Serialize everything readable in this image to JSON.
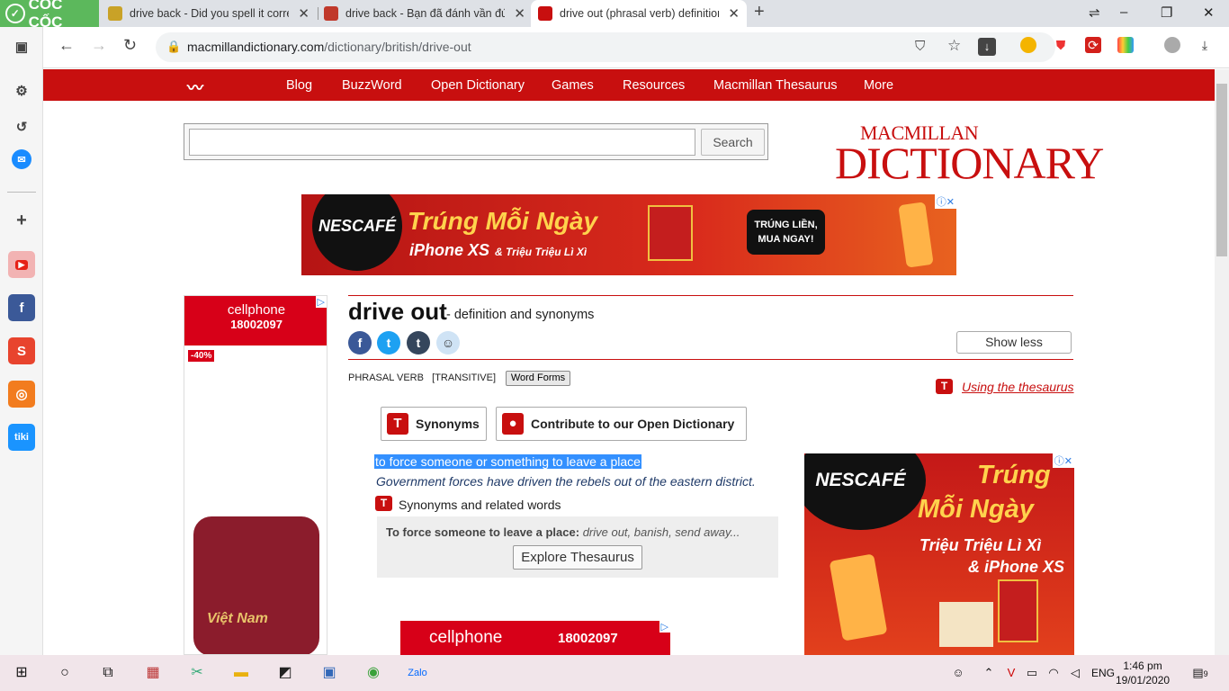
{
  "browser": {
    "brand": "CỐC CỐC",
    "tabs": [
      {
        "title": "drive back - Did you spell it correctly",
        "fav_color": "#c9a227"
      },
      {
        "title": "drive back - Bạn đã đánh vần đúng",
        "fav_color": "#c0392b"
      },
      {
        "title": "drive out (phrasal verb) definition and synonyms",
        "fav_color": "#c80f0f"
      }
    ],
    "url_domain": "macmillandictionary.com",
    "url_path": "/dictionary/british/drive-out"
  },
  "site": {
    "nav": [
      "Blog",
      "BuzzWord",
      "Open Dictionary",
      "Games",
      "Resources",
      "Macmillan Thesaurus",
      "More"
    ],
    "search_button": "Search",
    "logo_top": "MACMILLAN",
    "logo_main": "DICTIONARY"
  },
  "ads": {
    "top_brand": "NESCAFÉ",
    "top_line1": "Trúng Mỗi Ngày",
    "top_line2": "iPhone XS",
    "top_line2b": "& Triệu Triệu Lì Xì",
    "top_cta": "TRÚNG LIỀN, MUA NGAY!",
    "left_brand": "cellphone",
    "left_phone": "18002097",
    "left_discount": "-40%",
    "left_product": "Việt Nam",
    "right_brand": "NESCAFÉ",
    "right_line1": "Trúng",
    "right_line2": "Mỗi Ngày",
    "right_line3": "Triệu Triệu Lì Xì",
    "right_line4": "& iPhone XS",
    "bottom_brand": "cellphone",
    "bottom_phone": "18002097",
    "colors": {
      "red": "#c80f0f",
      "nescafe_red": "#d3201b"
    }
  },
  "entry": {
    "headword": "drive out",
    "subtitle": "- definition and synonyms",
    "show_less": "Show less",
    "part_of_speech": "PHRASAL VERB",
    "grammar": "[TRANSITIVE]",
    "word_forms": "Word Forms",
    "thesaurus_link": "Using the thesaurus",
    "synonyms_button": "Synonyms",
    "contribute_button": "Contribute to our Open Dictionary",
    "definition": "to force someone or something to leave a place",
    "example": "Government forces have driven the rebels out of the eastern district.",
    "synonyms_label": "Synonyms and related words",
    "syn_sense": "To force someone to leave a place:",
    "syn_words": "drive out, banish, send away...",
    "explore_button": "Explore Thesaurus"
  },
  "taskbar": {
    "lang": "ENG",
    "time": "1:46 pm",
    "date": "19/01/2020",
    "notifications": "9"
  }
}
